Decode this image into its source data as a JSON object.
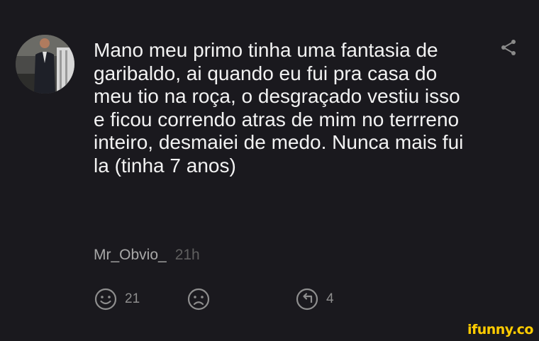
{
  "comment": {
    "text": "Mano meu primo tinha uma fantasia de garibaldo, ai quando eu fui pra casa do meu tio na roça, o desgraçado vestiu isso e ficou correndo atras de mim no terrreno inteiro, desmaiei de medo. Nunca mais fui la (tinha 7 anos)",
    "author": "Mr_Obvio_",
    "time": "21h",
    "avatar_icon": "user-avatar-photo"
  },
  "actions": {
    "smile_count": "21",
    "smile_icon": "smile-face-icon",
    "frown_icon": "frown-face-icon",
    "reply_count": "4",
    "reply_icon": "reply-icon",
    "share_icon": "share-icon"
  },
  "watermark": "ifunny.co"
}
